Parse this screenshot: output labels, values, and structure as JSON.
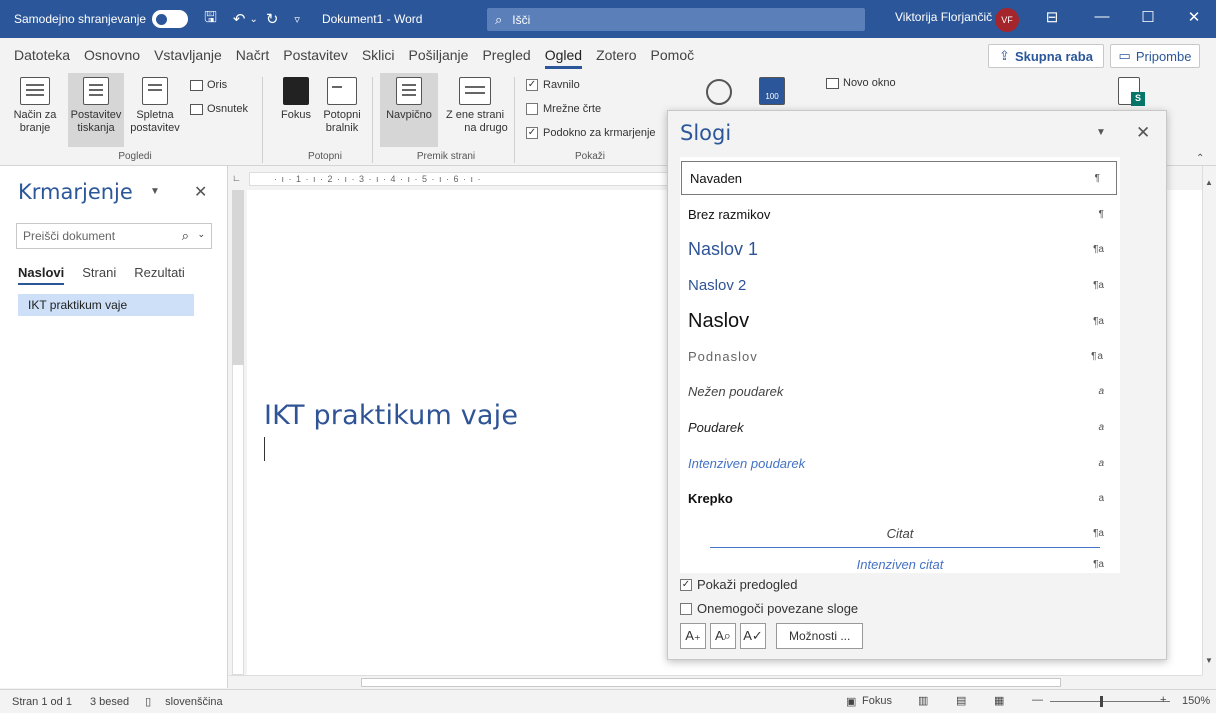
{
  "titlebar": {
    "autosave_label": "Samodejno shranjevanje",
    "doc_title": "Dokument1  -  Word",
    "search_placeholder": "Išči",
    "user_name": "Viktorija Florjančič",
    "avatar_initials": "VF"
  },
  "tabs": [
    "Datoteka",
    "Osnovno",
    "Vstavljanje",
    "Načrt",
    "Postavitev",
    "Sklici",
    "Pošiljanje",
    "Pregled",
    "Ogled",
    "Zotero",
    "Pomoč"
  ],
  "active_tab": "Ogled",
  "share_label": "Skupna raba",
  "comments_label": "Pripombe",
  "ribbon": {
    "views": {
      "read_mode": "Način za branje",
      "read_mode_l1": "Način za",
      "read_mode_l2": "branje",
      "print_layout_l1": "Postavitev",
      "print_layout_l2": "tiskanja",
      "web_layout_l1": "Spletna",
      "web_layout_l2": "postavitev",
      "outline": "Oris",
      "draft": "Osnutek",
      "group_label": "Pogledi"
    },
    "immersive": {
      "focus": "Fokus",
      "reader_l1": "Potopni",
      "reader_l2": "bralnik",
      "group_label": "Potopni"
    },
    "page_move": {
      "vertical": "Navpično",
      "side_l1": "Z ene strani",
      "side_l2": "na drugo",
      "group_label": "Premik strani"
    },
    "show": {
      "ruler": "Ravnilo",
      "gridlines": "Mrežne črte",
      "nav_pane": "Podokno za krmarjenje",
      "group_label": "Pokaži"
    },
    "window": {
      "new_window": "Novo okno"
    }
  },
  "navpane": {
    "title": "Krmarjenje",
    "search_placeholder": "Preišči dokument",
    "tabs": [
      "Naslovi",
      "Strani",
      "Rezultati"
    ],
    "items": [
      "IKT praktikum vaje"
    ]
  },
  "ruler_text": "·  ı  ·  1  ·  ı  ·  2  ·  ı  ·  3  ·  ı  ·  4  ·  ı  ·  5  ·  ı  ·  6  ·  ı  ·",
  "document": {
    "heading": "IKT praktikum vaje"
  },
  "styles_pane": {
    "title": "Slogi",
    "styles": [
      {
        "name": "Navaden",
        "mark": "¶"
      },
      {
        "name": "Brez razmikov",
        "mark": "¶"
      },
      {
        "name": "Naslov 1",
        "mark": "¶a"
      },
      {
        "name": "Naslov 2",
        "mark": "¶a"
      },
      {
        "name": "Naslov",
        "mark": "¶a"
      },
      {
        "name": "Podnaslov",
        "mark": "¶a"
      },
      {
        "name": "Nežen poudarek",
        "mark": "a"
      },
      {
        "name": "Poudarek",
        "mark": "a"
      },
      {
        "name": "Intenziven poudarek",
        "mark": "a"
      },
      {
        "name": "Krepko",
        "mark": "a"
      },
      {
        "name": "Citat",
        "mark": "¶a"
      },
      {
        "name": "Intenziven citat",
        "mark": "¶a"
      }
    ],
    "show_preview": "Pokaži predogled",
    "disable_linked": "Onemogoči povezane sloge",
    "options_label": "Možnosti ..."
  },
  "statusbar": {
    "page": "Stran 1 od 1",
    "words": "3 besed",
    "language": "slovenščina",
    "focus": "Fokus",
    "zoom": "150%"
  },
  "colors": {
    "brand": "#2b579a",
    "heading": "#2f5496"
  }
}
